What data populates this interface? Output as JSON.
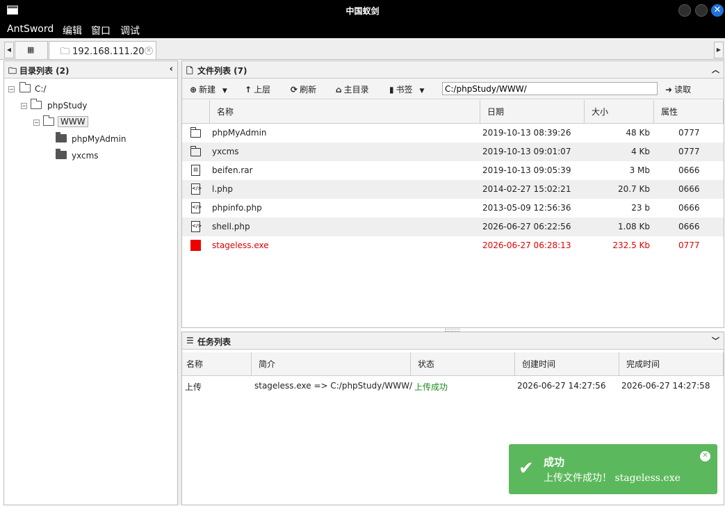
{
  "window": {
    "title": "中国蚁剑"
  },
  "menu": [
    "AntSword",
    "编辑",
    "窗口",
    "调试"
  ],
  "tabs": [
    {
      "label": "",
      "icon": "grid-icon"
    },
    {
      "label": "192.168.111.20",
      "icon": "folder-icon"
    }
  ],
  "left_panel": {
    "title": "目录列表 (2)",
    "tree": [
      {
        "name": "C:/",
        "level": 0,
        "expanded": true
      },
      {
        "name": "phpStudy",
        "level": 1,
        "expanded": true
      },
      {
        "name": "WWW",
        "level": 2,
        "expanded": true,
        "selected": true
      },
      {
        "name": "phpMyAdmin",
        "level": 3
      },
      {
        "name": "yxcms",
        "level": 3
      }
    ]
  },
  "file_panel": {
    "title": "文件列表 (7)",
    "toolbar": {
      "new_label": "新建",
      "up_label": "上层",
      "refresh_label": "刷新",
      "home_label": "主目录",
      "bookmark_label": "书签",
      "path_value": "C:/phpStudy/WWW/",
      "read_label": "读取"
    },
    "columns": [
      "名称",
      "日期",
      "大小",
      "属性"
    ],
    "files": [
      {
        "name": "phpMyAdmin",
        "date": "2019-10-13 08:39:26",
        "size": "48 Kb",
        "attr": "0777",
        "icon": "folder-icon"
      },
      {
        "name": "yxcms",
        "date": "2019-10-13 09:01:07",
        "size": "4 Kb",
        "attr": "0777",
        "icon": "folder-icon"
      },
      {
        "name": "beifen.rar",
        "date": "2019-10-13 09:05:39",
        "size": "3 Mb",
        "attr": "0666",
        "icon": "archive-file-icon"
      },
      {
        "name": "l.php",
        "date": "2014-02-27 15:02:21",
        "size": "20.7 Kb",
        "attr": "0666",
        "icon": "code-file-icon"
      },
      {
        "name": "phpinfo.php",
        "date": "2013-05-09 12:56:36",
        "size": "23 b",
        "attr": "0666",
        "icon": "code-file-icon"
      },
      {
        "name": "shell.php",
        "date": "2026-06-27 06:22:56",
        "size": "1.08 Kb",
        "attr": "0666",
        "icon": "code-file-icon"
      },
      {
        "name": "stageless.exe",
        "date": "2026-06-27 06:28:13",
        "size": "232.5 Kb",
        "attr": "0777",
        "icon": "exe-file-icon",
        "highlight": "#e00000"
      }
    ]
  },
  "task_panel": {
    "title": "任务列表",
    "columns": [
      "名称",
      "简介",
      "状态",
      "创建时间",
      "完成时间"
    ],
    "tasks": [
      {
        "name": "上传",
        "desc": "stageless.exe => C:/phpStudy/WWW/",
        "status": "上传成功",
        "created": "2026-06-27 14:27:56",
        "finished": "2026-06-27 14:27:58"
      }
    ]
  },
  "toast": {
    "title": "成功",
    "message": "上传文件成功！ stageless.exe",
    "color": "#5cb85c"
  },
  "colors": {
    "success_text": "#1a8a1a",
    "danger_text": "#e00000",
    "toast_bg": "#5cb85c"
  }
}
